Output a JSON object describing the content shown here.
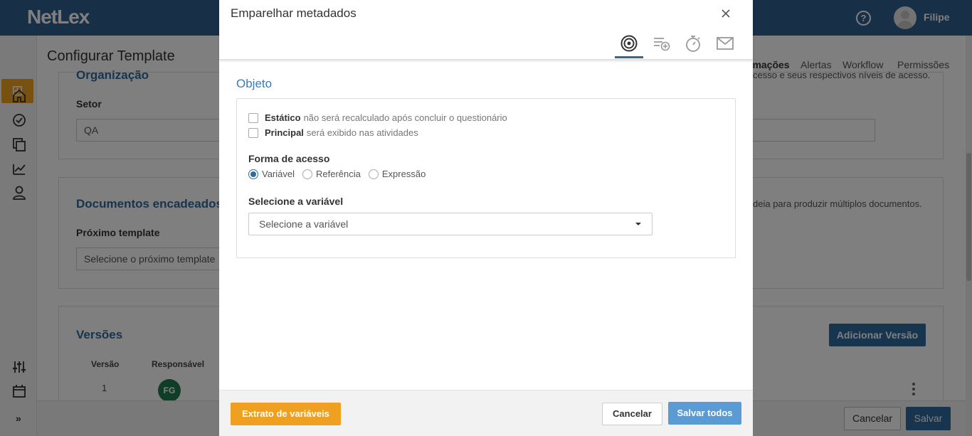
{
  "app": {
    "logo": "NetLex",
    "user_name": "Filipe",
    "help_icon": "help-circle-icon"
  },
  "page": {
    "title": "Configurar Template",
    "tabs": [
      {
        "label": "rmações",
        "active": true
      },
      {
        "label": "Alertas"
      },
      {
        "label": "Workflow"
      },
      {
        "label": "Permissões"
      }
    ]
  },
  "organizacao": {
    "title": "Organização",
    "setor_label": "Setor",
    "setor_value": "QA",
    "description": "cesso e seus respectivos níveis de acesso."
  },
  "documentos": {
    "title": "Documentos encadeados",
    "proximo_label": "Próximo template",
    "proximo_placeholder": "Selecione o próximo template",
    "description": "deia para produzir múltiplos documentos."
  },
  "versoes": {
    "title": "Versões",
    "add_button": "Adicionar Versão",
    "columns": [
      "Versão",
      "Responsável"
    ],
    "rows": [
      {
        "versao": "1",
        "responsavel_initials": "FG"
      }
    ]
  },
  "page_footer": {
    "cancel": "Cancelar",
    "save": "Salvar"
  },
  "modal": {
    "title": "Emparelhar metadados",
    "tabs": [
      {
        "icon": "target-icon",
        "active": true
      },
      {
        "icon": "list-add-icon"
      },
      {
        "icon": "stopwatch-icon"
      },
      {
        "icon": "envelope-icon"
      }
    ],
    "section_title": "Objeto",
    "static": {
      "label": "Estático",
      "hint": "não será recalculado após concluir o questionário",
      "checked": false
    },
    "principal": {
      "label": "Principal",
      "hint": "será exibido nas atividades",
      "checked": false
    },
    "access_label": "Forma de acesso",
    "access_options": [
      "Variável",
      "Referência",
      "Expressão"
    ],
    "access_selected": "Variável",
    "variable_label": "Selecione a variável",
    "variable_placeholder": "Selecione a variável",
    "footer": {
      "extract": "Extrato de variáveis",
      "cancel": "Cancelar",
      "save_all": "Salvar todos"
    }
  }
}
